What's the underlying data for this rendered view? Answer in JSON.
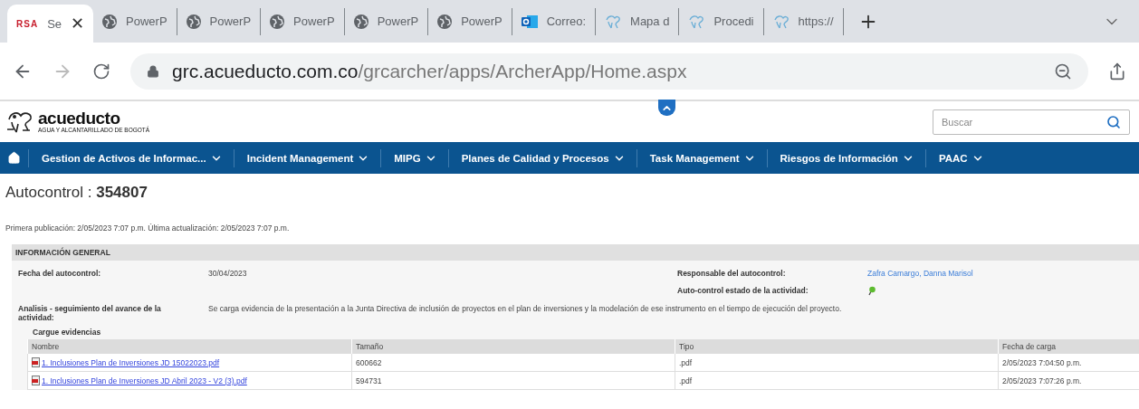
{
  "browser": {
    "tabs": [
      {
        "kind": "rsa",
        "logo": "RSA",
        "label": "Se",
        "selected": true,
        "close": "✕"
      },
      {
        "kind": "globe",
        "label": "PowerP",
        "selected": false
      },
      {
        "kind": "globe",
        "label": "PowerP",
        "selected": false
      },
      {
        "kind": "globe",
        "label": "PowerP",
        "selected": false
      },
      {
        "kind": "globe",
        "label": "PowerP",
        "selected": false
      },
      {
        "kind": "globe",
        "label": "PowerP",
        "selected": false
      },
      {
        "kind": "outlook",
        "label": "Correo:",
        "selected": false
      },
      {
        "kind": "app",
        "label": "Mapa d",
        "selected": false
      },
      {
        "kind": "app",
        "label": "Procedi",
        "selected": false
      },
      {
        "kind": "app",
        "label": "https://",
        "selected": false
      }
    ],
    "url": {
      "domain": "grc.acueducto.com.co",
      "path": "/grcarcher/apps/ArcherApp/Home.aspx"
    }
  },
  "header": {
    "logo": "acueducto",
    "logo_tagline": "AGUA Y ALCANTARILLADO DE BOGOTÁ",
    "search": {
      "placeholder": "Buscar"
    }
  },
  "nav": [
    "Gestion de Activos de Informac...",
    "Incident Management",
    "MIPG",
    "Planes de Calidad y Procesos",
    "Task Management",
    "Riesgos de Información",
    "PAAC"
  ],
  "record": {
    "title": "Autocontrol :",
    "id": "354807",
    "meta": "Primera publicación: 2/05/2023 7:07 p.m. Última actualización: 2/05/2023 7:07 p.m."
  },
  "section": {
    "title": "INFORMACIÓN GENERAL",
    "date": {
      "label": "Fecha del autocontrol:",
      "value": "30/04/2023"
    },
    "owner": {
      "label": "Responsable del autocontrol:",
      "value": "Zafra Camargo, Danna Marisol"
    },
    "status": {
      "label": "Auto-control estado de la actividad:"
    },
    "analysis": {
      "label": "Analisis - seguimiento del avance de la actividad:",
      "value": "Se carga evidencia de la presentación a la Junta Directiva de inclusión de proyectos en el plan de inversiones y la modelación de ese instrumento en el tiempo de ejecución del proyecto."
    },
    "evidence": {
      "title": "Cargue evidencias",
      "columns": [
        "Nombre",
        "Tamaño",
        "Tipo",
        "Fecha de carga"
      ],
      "rows": [
        [
          "1. Inclusiones Plan de Inversiones JD 15022023.pdf",
          "600662",
          ".pdf",
          "2/05/2023 7:04:50 p.m."
        ],
        [
          "1. Inclusiones Plan de Inversiones JD Abril 2023 - V2 (3).pdf",
          "594731",
          ".pdf",
          "2/05/2023 7:07:26 p.m."
        ]
      ]
    }
  }
}
